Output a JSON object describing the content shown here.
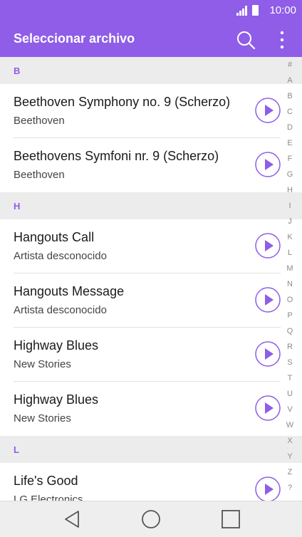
{
  "status_bar": {
    "time": "10:00",
    "icons": [
      "signal-icon",
      "battery-icon"
    ]
  },
  "app_bar": {
    "title": "Seleccionar archivo",
    "icons": [
      "search-icon",
      "more-vert-icon"
    ]
  },
  "list": {
    "sections": [
      {
        "header": "B",
        "items": [
          {
            "title": "Beethoven Symphony no. 9 (Scherzo)",
            "subtitle": "Beethoven"
          },
          {
            "title": "Beethovens Symfoni nr. 9 (Scherzo)",
            "subtitle": "Beethoven"
          }
        ]
      },
      {
        "header": "H",
        "items": [
          {
            "title": "Hangouts Call",
            "subtitle": "Artista desconocido"
          },
          {
            "title": "Hangouts Message",
            "subtitle": "Artista desconocido"
          },
          {
            "title": "Highway Blues",
            "subtitle": "New Stories"
          },
          {
            "title": "Highway Blues",
            "subtitle": "New Stories"
          }
        ]
      },
      {
        "header": "L",
        "items": [
          {
            "title": "Life's Good",
            "subtitle": "LG Electronics"
          }
        ]
      }
    ]
  },
  "index_letters": [
    "#",
    "A",
    "B",
    "C",
    "D",
    "E",
    "F",
    "G",
    "H",
    "I",
    "J",
    "K",
    "L",
    "M",
    "N",
    "O",
    "P",
    "Q",
    "R",
    "S",
    "T",
    "U",
    "V",
    "W",
    "X",
    "Y",
    "Z",
    "?"
  ],
  "nav_bar": {
    "icons": [
      "back-icon",
      "home-icon",
      "recents-icon"
    ]
  },
  "colors": {
    "accent": "#8f5de8",
    "section_bg": "#ececec",
    "nav_bg": "#eeeeee"
  }
}
